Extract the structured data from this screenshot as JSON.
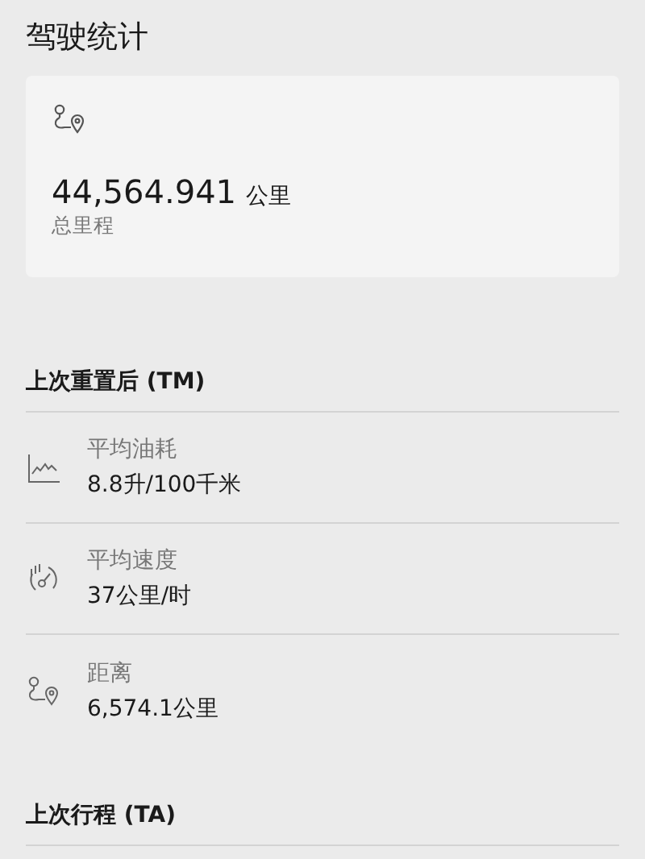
{
  "title": "驾驶统计",
  "odometer": {
    "value": "44,564.941",
    "unit": "公里",
    "label": "总里程"
  },
  "sections": [
    {
      "heading": "上次重置后 (TM)",
      "rows": [
        {
          "kind": "chart",
          "label": "平均油耗",
          "value": "8.8升/100千米"
        },
        {
          "kind": "gauge",
          "label": "平均速度",
          "value": "37公里/时"
        },
        {
          "kind": "route",
          "label": "距离",
          "value": "6,574.1公里"
        }
      ]
    },
    {
      "heading": "上次行程 (TA)"
    }
  ]
}
